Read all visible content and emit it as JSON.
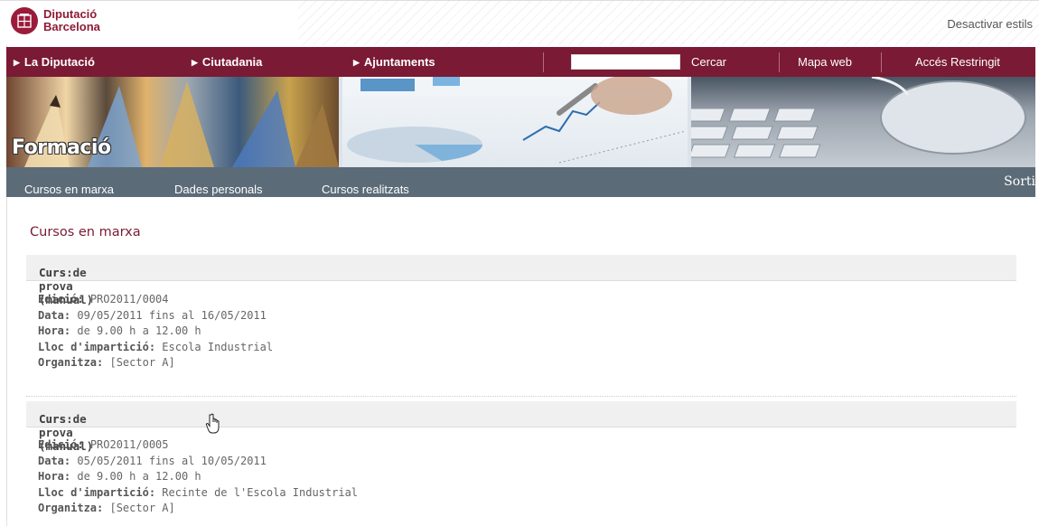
{
  "header": {
    "logo_line1": "Diputació",
    "logo_line2": "Barcelona",
    "desactivar_estils": "Desactivar estils"
  },
  "mainnav": {
    "items": [
      "La Diputació",
      "Ciutadania",
      "Ajuntaments"
    ],
    "search_button": "Cercar",
    "mapa_web": "Mapa web",
    "acces_restringit": "Accés Restringit"
  },
  "banner": {
    "title": "Formació"
  },
  "subnav": {
    "items": [
      "Cursos en marxa",
      "Dades personals",
      "Cursos realitzats"
    ],
    "sortir": "Sorti"
  },
  "content": {
    "section_title": "Cursos en marxa",
    "labels": {
      "curs": "Curs:",
      "edicio": "Edició:",
      "data": "Data:",
      "hora": "Hora:",
      "lloc": "Lloc d'impartició:",
      "organitza": "Organitza:"
    },
    "courses": [
      {
        "name": "Curs de prova (manual)",
        "edicio": "PRO2011/0004",
        "data": "09/05/2011 fins al 16/05/2011",
        "hora": "de 9.00 h a 12.00 h",
        "lloc": "Escola Industrial",
        "organitza": "[Sector A]"
      },
      {
        "name": "Curs de prova (manual)",
        "edicio": "PRO2011/0005",
        "data": "05/05/2011 fins al 10/05/2011",
        "hora": "de 9.00 h a 12.00 h",
        "lloc": "Recinte de l'Escola Industrial",
        "organitza": "[Sector A]"
      }
    ]
  },
  "colors": {
    "brand": "#7a1a34",
    "subnav": "#5b6b78"
  }
}
